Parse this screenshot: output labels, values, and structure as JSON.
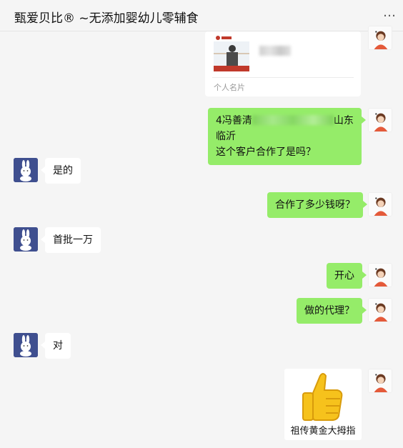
{
  "header": {
    "title": "甄爱贝比® ~无添加婴幼儿零辅食",
    "more_icon": "more-dots-icon"
  },
  "messages": [
    {
      "id": "card",
      "side": "right",
      "type": "contact-card",
      "card_label": "个人名片"
    },
    {
      "id": "m1",
      "side": "right",
      "type": "text",
      "line1_prefix": "4冯善清",
      "line1_suffix": "山东临沂",
      "line2": "这个客户合作了是吗？"
    },
    {
      "id": "m2",
      "side": "left",
      "type": "text",
      "text": "是的"
    },
    {
      "id": "m3",
      "side": "right",
      "type": "text",
      "text": "合作了多少钱呀？"
    },
    {
      "id": "m4",
      "side": "left",
      "type": "text",
      "text": "首批一万"
    },
    {
      "id": "m5",
      "side": "right",
      "type": "text",
      "text": "开心"
    },
    {
      "id": "m6",
      "side": "right",
      "type": "text",
      "text": "做的代理？"
    },
    {
      "id": "m7",
      "side": "left",
      "type": "text",
      "text": "对"
    },
    {
      "id": "m8",
      "side": "right",
      "type": "sticker",
      "caption": "祖传黄金大拇指",
      "icon": "thumbs-up-icon"
    }
  ],
  "colors": {
    "background": "#f5f5f5",
    "bubble_self": "#95ec69",
    "bubble_other": "#ffffff",
    "left_avatar_bg": "#3f4f8f"
  }
}
